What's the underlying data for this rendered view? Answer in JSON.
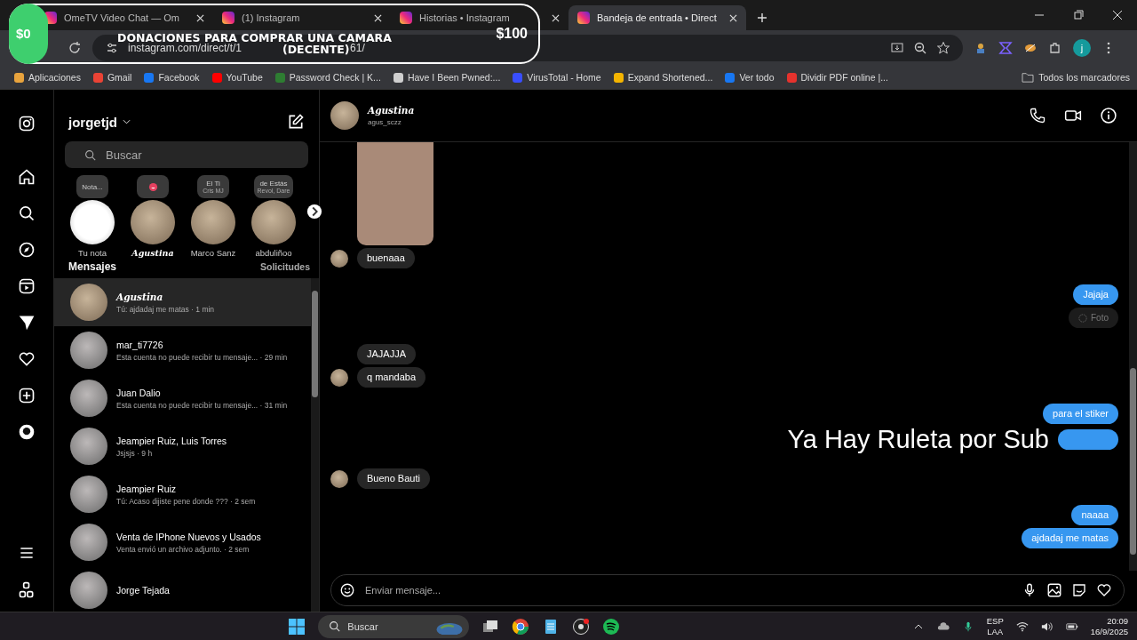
{
  "overlay": {
    "level": 0,
    "start": "$0",
    "title": "DONACIONES PARA COMPRAR UNA CAMARA",
    "subtitle": "(DECENTE)",
    "goal": "$100",
    "caption": "Ya Hay Ruleta por Sub"
  },
  "browser": {
    "tabs": [
      {
        "label": "OmeTV Video Chat — Om",
        "selected": false
      },
      {
        "label": "(1) Instagram",
        "selected": false
      },
      {
        "label": "Historias • Instagram",
        "selected": false
      },
      {
        "label": "Bandeja de entrada • Direct",
        "selected": true
      }
    ],
    "url": "instagram.com/direct/t/1",
    "url_end": "61/",
    "profile": "j",
    "bookmarks": [
      {
        "label": "Aplicaciones",
        "kind": "apps"
      },
      {
        "label": "Gmail",
        "kind": "mail"
      },
      {
        "label": "Facebook",
        "kind": "fb"
      },
      {
        "label": "YouTube",
        "kind": "yt"
      },
      {
        "label": "Password Check | K...",
        "kind": "key"
      },
      {
        "label": "Have I Been Pwned:...",
        "kind": "dots"
      },
      {
        "label": "VirusTotal - Home",
        "kind": "vt"
      },
      {
        "label": "Expand Shortened...",
        "kind": "link"
      },
      {
        "label": "Ver todo",
        "kind": "fb"
      },
      {
        "label": "Dividir PDF online |...",
        "kind": "pdf"
      }
    ],
    "all_bookmarks": "Todos los marcadores"
  },
  "inbox": {
    "username": "jorgetjd",
    "search": {
      "placeholder": "Buscar"
    },
    "notes": [
      {
        "kind": "text",
        "note": "Nota...",
        "name": "Tu nota",
        "stylized": false
      },
      {
        "kind": "emoji",
        "name": "Agustina",
        "stylized": true
      },
      {
        "kind": "text",
        "note": "El Ti",
        "note_sub": "Cris MJ",
        "name": "Marco Sanz",
        "stylized": false
      },
      {
        "kind": "text",
        "note": "de Estás",
        "note_sub": "Revol, Dare",
        "name": "abduliñoo",
        "stylized": false
      }
    ],
    "section": "Mensajes",
    "requests": "Solicitudes",
    "conversations": [
      {
        "name": "Agustina",
        "stylized": true,
        "preview": "Tú: ajdadaj me matas · 1 min",
        "selected": true
      },
      {
        "name": "mar_ti7726",
        "stylized": false,
        "preview": "Esta cuenta no puede recibir tu mensaje... · 29 min",
        "selected": false
      },
      {
        "name": "Juan Dalio",
        "stylized": false,
        "preview": "Esta cuenta no puede recibir tu mensaje... · 31 min",
        "selected": false
      },
      {
        "name": "Jeampier Ruiz, Luis Torres",
        "stylized": false,
        "preview": "Jsjsjs · 9 h",
        "selected": false
      },
      {
        "name": "Jeampier Ruiz",
        "stylized": false,
        "preview": "Tú: Acaso dijiste pene donde ??? · 2 sem",
        "selected": false
      },
      {
        "name": "Venta de IPhone Nuevos y Usados",
        "stylized": false,
        "preview": "Venta envió un archivo adjunto. · 2 sem",
        "selected": false
      },
      {
        "name": "Jorge Tejada",
        "stylized": false,
        "selected": false
      }
    ]
  },
  "chat": {
    "name": "Agustina",
    "handle": "agus_sczz",
    "placeholder": "Enviar mensaje...",
    "groups": [
      {
        "kind": "in",
        "messages": [
          {
            "kind": "photo"
          },
          {
            "kind": "text",
            "text": "buenaaa"
          }
        ]
      },
      {
        "kind": "out",
        "messages": [
          {
            "kind": "text",
            "text": "Jajaja"
          },
          {
            "kind": "unavailable",
            "text": "Foto"
          }
        ]
      },
      {
        "kind": "in",
        "messages": [
          {
            "kind": "text",
            "text": "JAJAJJA"
          },
          {
            "kind": "text",
            "text": "q mandaba"
          }
        ]
      },
      {
        "kind": "out",
        "messages": [
          {
            "kind": "text",
            "text": "para el stiker"
          },
          {
            "kind": "covered"
          }
        ]
      },
      {
        "kind": "in",
        "messages": [
          {
            "kind": "text",
            "text": "Bueno Bauti"
          }
        ]
      },
      {
        "kind": "out",
        "messages": [
          {
            "kind": "text",
            "text": "naaaa"
          },
          {
            "kind": "text",
            "text": "ajdadaj me matas"
          }
        ]
      }
    ]
  },
  "taskbar": {
    "search": "Buscar",
    "lang": "ESP",
    "layout": "LAA",
    "time": "20:09",
    "date": "16/9/2025"
  }
}
